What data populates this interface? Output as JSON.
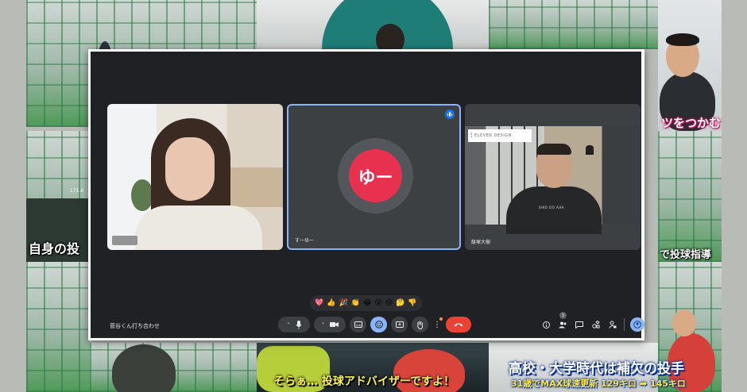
{
  "background": {
    "captions": {
      "right_top": "ツをつかむ",
      "left_mid": "自身の投",
      "right_mid": "で投球指導",
      "bottom_left": "そらぁ… 投球アドバイザーですよ！",
      "bottom_right_main": "高校・大学時代は補欠の投手",
      "bottom_right_sub": "31歳でMAX球速更新 129キロ ➡ 145キロ",
      "score_overlay": "171.6"
    }
  },
  "meet": {
    "meeting_name": "菅谷くん打ち合わせ",
    "participants": [
      {
        "name": ""
      },
      {
        "name": "すーゆー",
        "avatar_text": "ゆー"
      },
      {
        "name": "飯塚大樹",
        "logo_text": "ELEVEN DESIGN",
        "shirt_text": "SIKO OO AAA"
      }
    ],
    "reactions": [
      "💖",
      "👍",
      "🎉",
      "👏",
      "😂",
      "😮",
      "😢",
      "🤔",
      "👎"
    ],
    "participant_count": "3",
    "colors": {
      "window_bg": "#202124",
      "tile_bg": "#3c4043",
      "active_border": "#8ab4f8",
      "avatar_bg": "#e8304f",
      "end_call": "#ea4335"
    }
  }
}
